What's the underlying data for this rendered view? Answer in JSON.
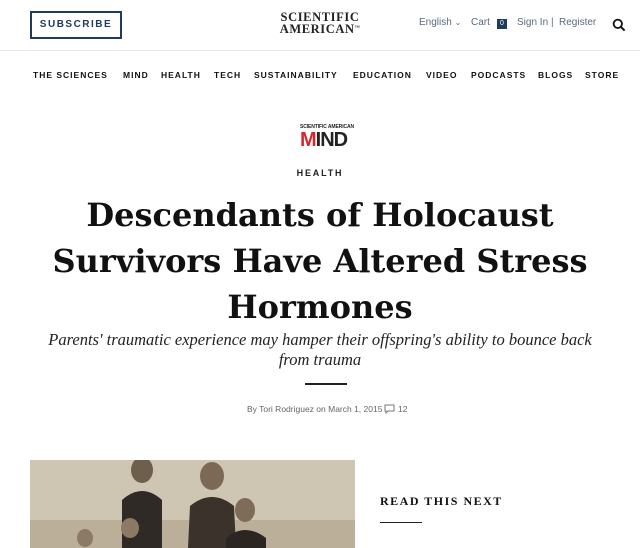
{
  "header": {
    "subscribe_label": "SUBSCRIBE",
    "logo_line1": "SCIENTIFIC",
    "logo_line2": "AMERICAN",
    "language_label": "English",
    "cart_label": "Cart",
    "cart_count": "0",
    "sign_in_label": "Sign In",
    "divider": "|",
    "register_label": "Register"
  },
  "nav": {
    "items": [
      "THE SCIENCES",
      "MIND",
      "HEALTH",
      "TECH",
      "SUSTAINABILITY",
      "EDUCATION",
      "VIDEO",
      "PODCASTS",
      "BLOGS",
      "STORE"
    ]
  },
  "section_logo": {
    "small_text": "SCIENTIFIC AMERICAN",
    "mind_first": "M",
    "mind_rest": "IND"
  },
  "article": {
    "category": "HEALTH",
    "headline": "Descendants of Holocaust Survivors Have Altered Stress Hormones",
    "dek": "Parents' traumatic experience may hamper their offspring's ability to bounce back from trauma",
    "byline": "By Tori Rodriguez on March 1, 2015",
    "comment_count": "12"
  },
  "sidebar": {
    "read_next_label": "READ THIS NEXT"
  },
  "colors": {
    "brand_navy": "#1f3a5a",
    "mind_red": "#d6262c"
  }
}
